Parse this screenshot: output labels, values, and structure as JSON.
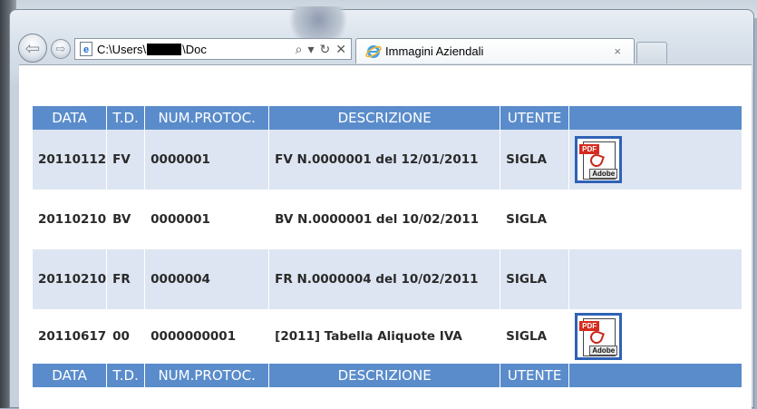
{
  "browser": {
    "address_prefix": "C:\\Users\\",
    "address_suffix": "\\Doc",
    "tab_title": "Immagini Aziendali",
    "tab_close": "×",
    "search_glyph": "⌕",
    "dropdown_glyph": "▾",
    "refresh_glyph": "↻",
    "stop_glyph": "✕",
    "back_glyph": "⇦",
    "forward_glyph": "⇨"
  },
  "table": {
    "headers": [
      "DATA",
      "T.D.",
      "NUM.PROTOC.",
      "DESCRIZIONE",
      "UTENTE",
      ""
    ],
    "rows": [
      {
        "data": "20110112",
        "td": "FV",
        "num": "0000001",
        "descrizione": "FV N.0000001 del 12/01/2011",
        "utente": "SIGLA",
        "has_pdf": true
      },
      {
        "data": "20110210",
        "td": "BV",
        "num": "0000001",
        "descrizione": "BV N.0000001 del 10/02/2011",
        "utente": "SIGLA",
        "has_pdf": false
      },
      {
        "data": "20110210",
        "td": "FR",
        "num": "0000004",
        "descrizione": "FR N.0000004 del 10/02/2011",
        "utente": "SIGLA",
        "has_pdf": false
      },
      {
        "data": "20110617",
        "td": "00",
        "num": "0000000001",
        "descrizione": "[2011] Tabella Aliquote IVA",
        "utente": "SIGLA",
        "has_pdf": true
      }
    ],
    "pdf_label": "PDF",
    "adobe_label": "Adobe"
  },
  "colors": {
    "header_bg": "#5a8ccb",
    "row_shaded": "#dde5f2",
    "pdf_border": "#2f62b6"
  }
}
